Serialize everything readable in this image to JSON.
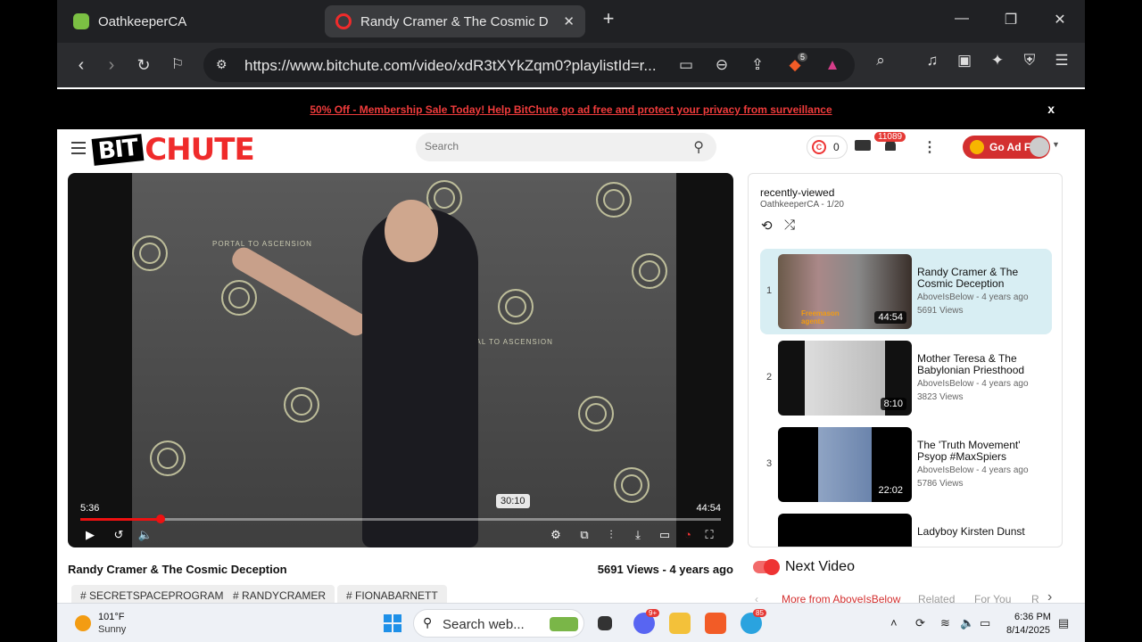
{
  "browser": {
    "tabs": [
      {
        "title": "OathkeeperCA"
      },
      {
        "title": "Randy Cramer & The Cosmic Dec"
      }
    ],
    "url": "https://www.bitchute.com/video/xdR3tXYkZqm0?playlistId=r...",
    "brave_badge": "5"
  },
  "promo": {
    "text": "50% Off - Membership Sale Today! Help BitChute go ad free and protect your privacy from surveillance",
    "close": "x"
  },
  "header": {
    "logo_bit": "BIT",
    "logo_chute": "CHUTE",
    "search_placeholder": "Search",
    "coins": "0",
    "notifications": "11089",
    "ad_free_label": "Go Ad Free"
  },
  "player": {
    "current_time": "5:36",
    "total_time": "44:54",
    "hover_time": "30:10",
    "progress_fraction": 0.125,
    "backdrop_text": "PORTAL TO ASCENSION"
  },
  "video": {
    "title": "Randy Cramer & The Cosmic Deception",
    "meta": "5691 Views - 4 years ago",
    "tags": [
      "SECRETSPACEPROGRAM",
      "RANDYCRAMER",
      "FIONABARNETT"
    ]
  },
  "playlist": {
    "title": "recently-viewed",
    "subtitle": "OathkeeperCA - 1/20",
    "items": [
      {
        "index": "1",
        "title": "Randy Cramer & The Cosmic Deception",
        "channel": "AboveIsBelow - 4 years ago",
        "views": "5691 Views",
        "duration": "44:54",
        "thumb_caption": "Freemason agents"
      },
      {
        "index": "2",
        "title": "Mother Teresa & The Babylonian Priesthood",
        "channel": "AboveIsBelow - 4 years ago",
        "views": "3823 Views",
        "duration": "8:10"
      },
      {
        "index": "3",
        "title": "The 'Truth Movement' Psyop #MaxSpiers",
        "channel": "AboveIsBelow - 4 years ago",
        "views": "5786 Views",
        "duration": "22:02"
      },
      {
        "index": "",
        "title": "Ladyboy Kirsten Dunst",
        "channel": "",
        "views": "",
        "duration": ""
      }
    ]
  },
  "next": {
    "label": "Next Video",
    "tabs": [
      "More from AboveIsBelow",
      "Related",
      "For You",
      "R"
    ]
  },
  "taskbar": {
    "temp": "101°F",
    "condition": "Sunny",
    "search_text": "Search web...",
    "time": "6:36 PM",
    "date": "8/14/2025",
    "discord_badge": "9+",
    "telegram_badge": "85"
  },
  "colors": {
    "accent": "#ef2b2b",
    "active_item": "#d8eef3",
    "chrome": "#202124"
  }
}
